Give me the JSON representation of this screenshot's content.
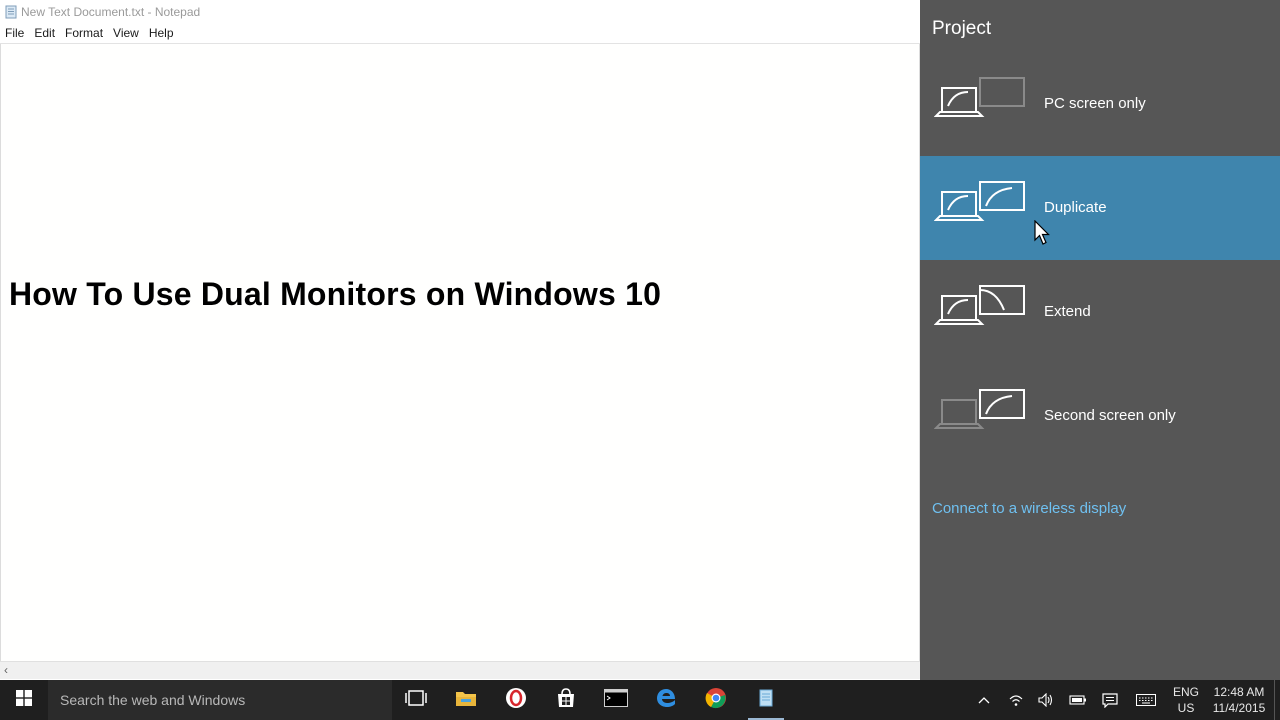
{
  "notepad": {
    "title": "New Text Document.txt - Notepad",
    "menu": [
      "File",
      "Edit",
      "Format",
      "View",
      "Help"
    ],
    "content": "How To Use Dual Monitors on Windows 10"
  },
  "project_panel": {
    "title": "Project",
    "options": [
      {
        "label": "PC screen only",
        "icon": "pc-screen-only-icon",
        "selected": false
      },
      {
        "label": "Duplicate",
        "icon": "duplicate-icon",
        "selected": true
      },
      {
        "label": "Extend",
        "icon": "extend-icon",
        "selected": false
      },
      {
        "label": "Second screen only",
        "icon": "second-screen-only-icon",
        "selected": false
      }
    ],
    "wireless_link": "Connect to a wireless display",
    "selected_color": "#3f85ad",
    "link_color": "#6fc0f0"
  },
  "taskbar": {
    "search_placeholder": "Search the web and Windows",
    "apps": [
      "task-view-icon",
      "file-explorer-icon",
      "opera-icon",
      "store-icon",
      "command-prompt-icon",
      "edge-icon",
      "chrome-icon",
      "notepad-icon"
    ],
    "language": {
      "line1": "ENG",
      "line2": "US"
    },
    "clock": {
      "time": "12:48 AM",
      "date": "11/4/2015"
    }
  }
}
